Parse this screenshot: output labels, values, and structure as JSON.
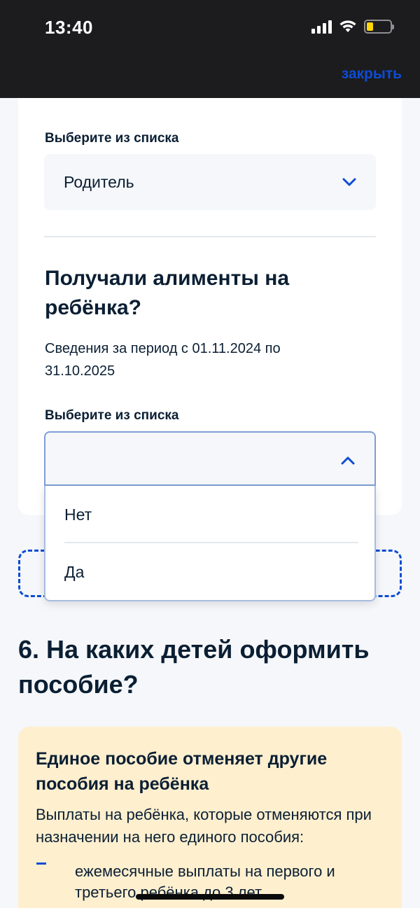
{
  "status_bar": {
    "time": "13:40"
  },
  "header": {
    "close_label": "закрыть"
  },
  "form": {
    "relation_field": {
      "label": "Выберите из списка",
      "value": "Родитель"
    },
    "alimony_question": {
      "title": "Получали алименты на ребёнка?",
      "subtitle": "Сведения за период с 01.11.2024 по 31.10.2025",
      "field_label": "Выберите из списка",
      "value": "",
      "options": [
        {
          "label": "Нет"
        },
        {
          "label": "Да"
        }
      ]
    }
  },
  "section": {
    "title": "6. На каких детей оформить пособие?"
  },
  "info_card": {
    "title": "Единое пособие отменяет другие пособия на ребёнка",
    "text": "Выплаты на ребёнка, которые отменяются при назначении на него единого пособия:",
    "bullets": [
      "ежемесячные выплаты на первого и третьего ребёнка до 3 лет"
    ]
  },
  "colors": {
    "accent": "#0d4cd3",
    "text": "#0b1f33",
    "info_bg": "#feefcf",
    "page_bg": "#f5f7fa"
  }
}
